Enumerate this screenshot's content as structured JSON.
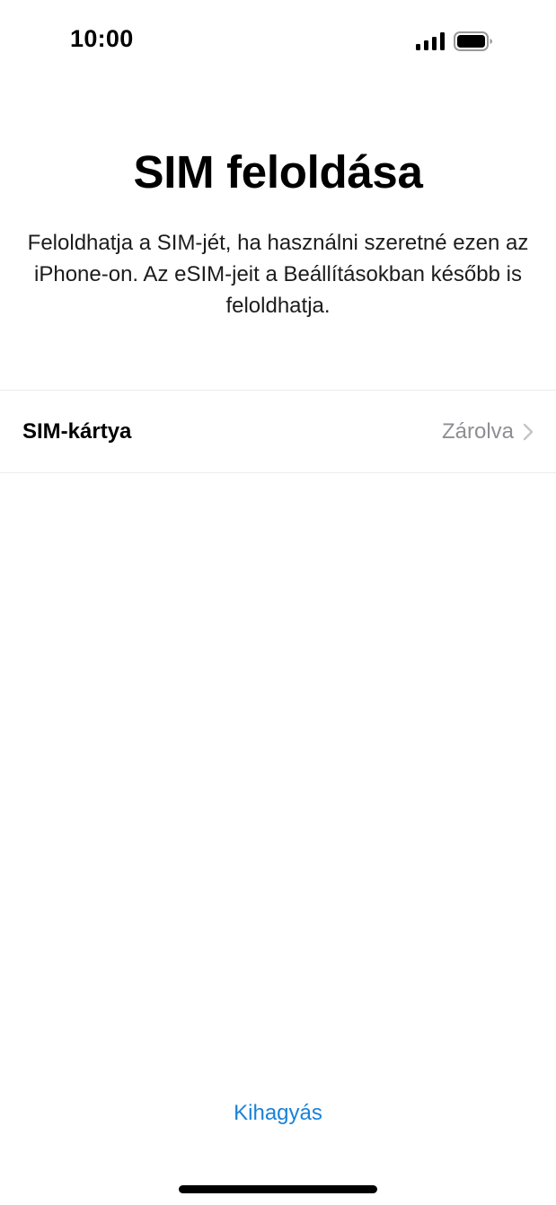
{
  "status_bar": {
    "time": "10:00",
    "signal_icon": "cellular-signal-icon",
    "battery_icon": "battery-full-icon"
  },
  "title": "SIM feloldása",
  "description": "Feloldhatja a SIM-jét, ha használni szeretné ezen az iPhone-on. Az eSIM-jeit a Beállításokban később is feloldhatja.",
  "sim_row": {
    "label": "SIM-kártya",
    "value": "Zárolva",
    "chevron_icon": "chevron-right-icon"
  },
  "skip_label": "Kihagyás",
  "colors": {
    "accent": "#1a82d8",
    "secondary_text": "#8e8e93",
    "divider": "#ececec"
  }
}
